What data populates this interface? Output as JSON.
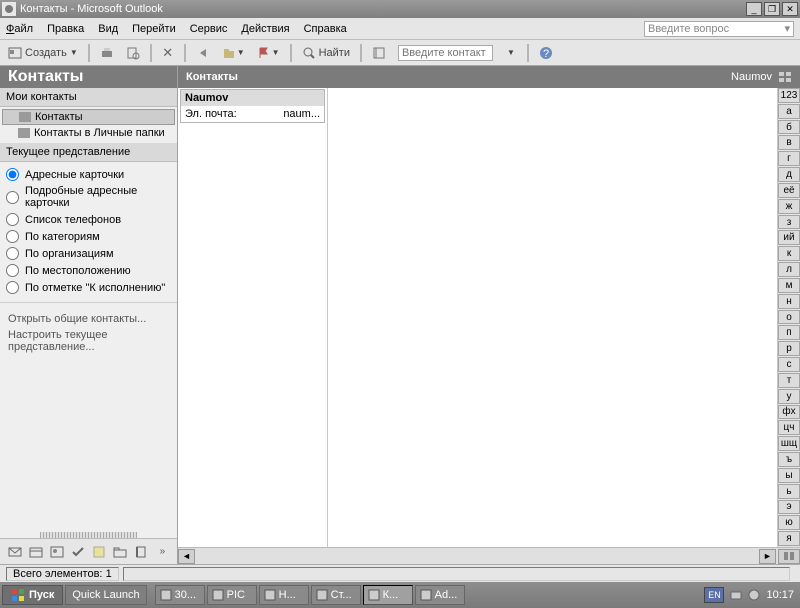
{
  "window": {
    "title": "Контакты - Microsoft Outlook"
  },
  "menu": {
    "file": "Файл",
    "edit": "Правка",
    "view": "Вид",
    "go": "Перейти",
    "tools": "Сервис",
    "actions": "Действия",
    "help": "Справка",
    "ask": "Введите вопрос"
  },
  "toolbar": {
    "create": "Создать",
    "find": "Найти",
    "contact_placeholder": "Введите контакт"
  },
  "nav": {
    "header": "Контакты",
    "section_my": "Мои контакты",
    "items": [
      {
        "label": "Контакты",
        "selected": true
      },
      {
        "label": "Контакты в Личные папки",
        "selected": false
      }
    ],
    "section_view": "Текущее представление",
    "views": [
      "Адресные карточки",
      "Подробные адресные карточки",
      "Список телефонов",
      "По категориям",
      "По организациям",
      "По местоположению",
      "По отметке \"К исполнению\""
    ],
    "selected_view": 0,
    "link_open": "Открыть общие контакты...",
    "link_customize": "Настроить текущее представление..."
  },
  "content": {
    "header": "Контакты",
    "right_label": "Naumov",
    "cards": [
      {
        "name": "Naumov",
        "email_label": "Эл. почта:",
        "email_value": "naum..."
      }
    ]
  },
  "alpha": [
    "123",
    "а",
    "б",
    "в",
    "г",
    "д",
    "её",
    "ж",
    "з",
    "ий",
    "к",
    "л",
    "м",
    "н",
    "о",
    "п",
    "р",
    "с",
    "т",
    "у",
    "фх",
    "цч",
    "шщ",
    "ъ",
    "ы",
    "ь",
    "э",
    "ю",
    "я"
  ],
  "status": {
    "count_label": "Всего элементов:",
    "count": "1"
  },
  "taskbar": {
    "start": "Пуск",
    "quicklaunch": "Quick Launch",
    "tasks": [
      {
        "label": "30..."
      },
      {
        "label": "PIC"
      },
      {
        "label": "Н..."
      },
      {
        "label": "Ст..."
      },
      {
        "label": "К...",
        "active": true
      },
      {
        "label": "Ad..."
      }
    ],
    "lang": "EN",
    "clock": "10:17"
  }
}
